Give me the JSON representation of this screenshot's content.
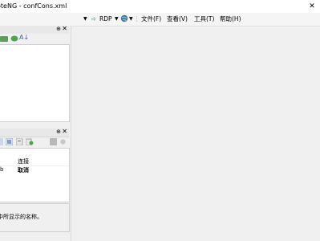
{
  "window": {
    "title": "oteNG - confCons.xml",
    "close_glyph": "✕"
  },
  "toolbar": {
    "rdp_label": "RDP",
    "menu": [
      "文件(F)",
      "查看(V)",
      "工具(T)",
      "帮助(H)"
    ]
  },
  "connections_panel": {
    "pin": "⊕",
    "close": "✕"
  },
  "config_panel": {
    "pin": "⊕",
    "close": "✕"
  },
  "properties": {
    "rows": [
      {
        "key": "",
        "value": "连接"
      },
      {
        "key": "b",
        "value": "取消"
      }
    ]
  },
  "description": {
    "text": "树中所显示的名称。"
  }
}
